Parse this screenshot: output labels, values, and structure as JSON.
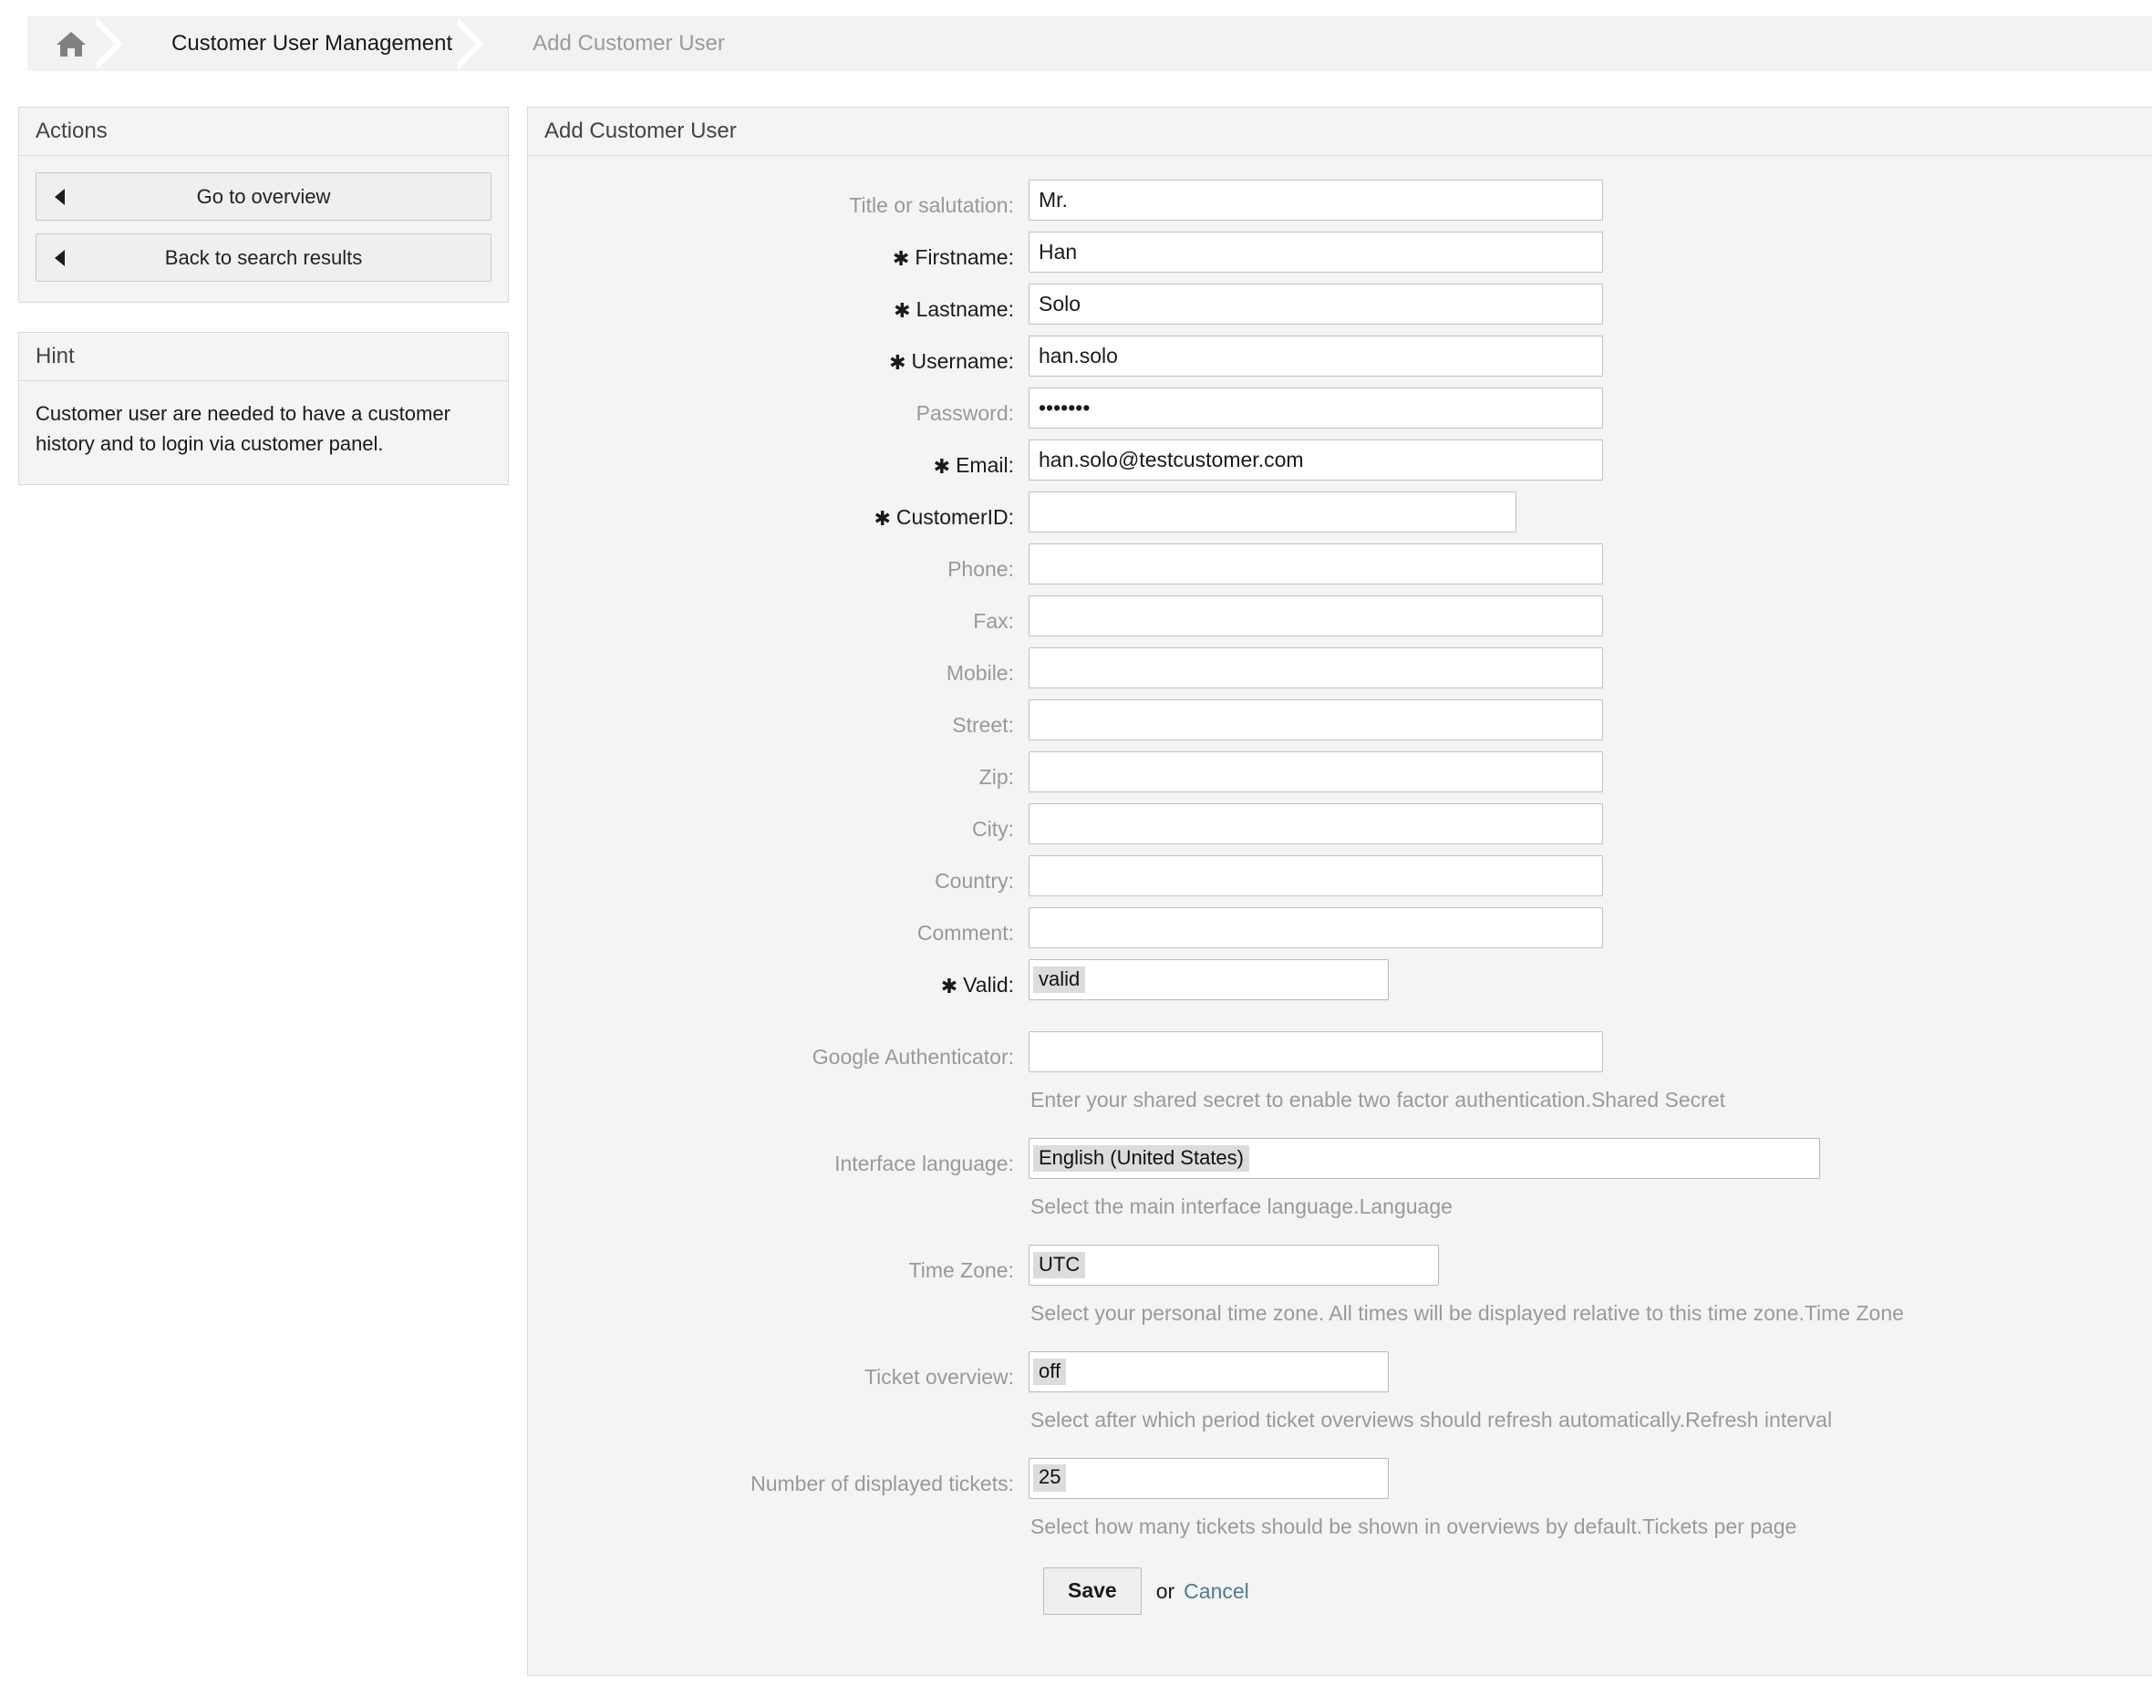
{
  "breadcrumb": {
    "home_icon": "home-icon",
    "items": [
      {
        "label": "Customer User Management",
        "active": true
      },
      {
        "label": "Add Customer User",
        "active": false
      }
    ]
  },
  "sidebar": {
    "actions": {
      "title": "Actions",
      "buttons": [
        {
          "label": "Go to overview",
          "icon": "arrow-left-icon"
        },
        {
          "label": "Back to search results",
          "icon": "arrow-left-icon"
        }
      ]
    },
    "hint": {
      "title": "Hint",
      "text": "Customer user are needed to have a customer history and to login via customer panel."
    }
  },
  "main": {
    "title": "Add Customer User",
    "fields": {
      "title_salutation": {
        "label": "Title or salutation:",
        "value": "Mr.",
        "required": false
      },
      "firstname": {
        "label": "Firstname:",
        "value": "Han",
        "required": true
      },
      "lastname": {
        "label": "Lastname:",
        "value": "Solo",
        "required": true
      },
      "username": {
        "label": "Username:",
        "value": "han.solo",
        "required": true
      },
      "password": {
        "label": "Password:",
        "value": "•••••••",
        "required": false
      },
      "email": {
        "label": "Email:",
        "value": "han.solo@testcustomer.com",
        "required": true
      },
      "customer_id": {
        "label": "CustomerID:",
        "value": "",
        "required": true
      },
      "phone": {
        "label": "Phone:",
        "value": "",
        "required": false
      },
      "fax": {
        "label": "Fax:",
        "value": "",
        "required": false
      },
      "mobile": {
        "label": "Mobile:",
        "value": "",
        "required": false
      },
      "street": {
        "label": "Street:",
        "value": "",
        "required": false
      },
      "zip": {
        "label": "Zip:",
        "value": "",
        "required": false
      },
      "city": {
        "label": "City:",
        "value": "",
        "required": false
      },
      "country": {
        "label": "Country:",
        "value": "",
        "required": false
      },
      "comment": {
        "label": "Comment:",
        "value": "",
        "required": false
      },
      "valid": {
        "label": "Valid:",
        "value": "valid",
        "required": true
      },
      "google_authenticator": {
        "label": "Google Authenticator:",
        "value": "",
        "required": false,
        "description": "Enter your shared secret to enable two factor authentication.Shared Secret"
      },
      "interface_language": {
        "label": "Interface language:",
        "value": "English (United States)",
        "required": false,
        "description": "Select the main interface language.Language"
      },
      "time_zone": {
        "label": "Time Zone:",
        "value": "UTC",
        "required": false,
        "description": "Select your personal time zone. All times will be displayed relative to this time zone.Time Zone"
      },
      "ticket_overview": {
        "label": "Ticket overview:",
        "value": "off",
        "required": false,
        "description": "Select after which period ticket overviews should refresh automatically.Refresh interval"
      },
      "displayed_tickets": {
        "label": "Number of displayed tickets:",
        "value": "25",
        "required": false,
        "description": "Select how many tickets should be shown in overviews by default.Tickets per page"
      }
    },
    "submit": {
      "save_label": "Save",
      "or_label": "or",
      "cancel_label": "Cancel"
    }
  },
  "colors": {
    "panel_bg": "#f4f4f4",
    "border": "#d8d8d8",
    "label_muted": "#999999",
    "link": "#4d7a96",
    "select_highlight": "#dcdcdc"
  }
}
